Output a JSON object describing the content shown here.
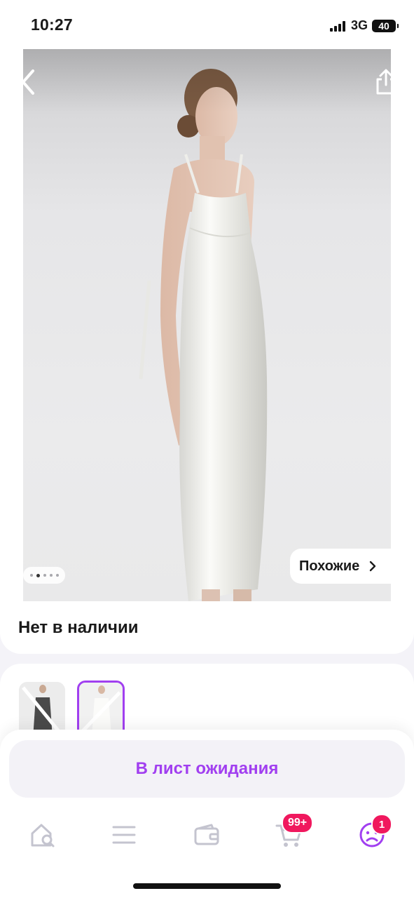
{
  "status_bar": {
    "time": "10:27",
    "network": "3G",
    "battery": "40"
  },
  "product": {
    "availability": "Нет в наличии",
    "gallery_pages": 5,
    "gallery_active_index": 1
  },
  "actions": {
    "similar_label": "Похожие",
    "waitlist_label": "В лист ожидания"
  },
  "tabbar": {
    "items": [
      {
        "icon": "home-search-icon"
      },
      {
        "icon": "menu-icon"
      },
      {
        "icon": "wallet-icon"
      },
      {
        "icon": "cart-icon",
        "badge": "99+"
      },
      {
        "icon": "profile-icon",
        "badge": "1"
      }
    ]
  },
  "colors": {
    "accent": "#a13ff0",
    "badge": "#f0185e",
    "icon": "#c4c4cf"
  }
}
